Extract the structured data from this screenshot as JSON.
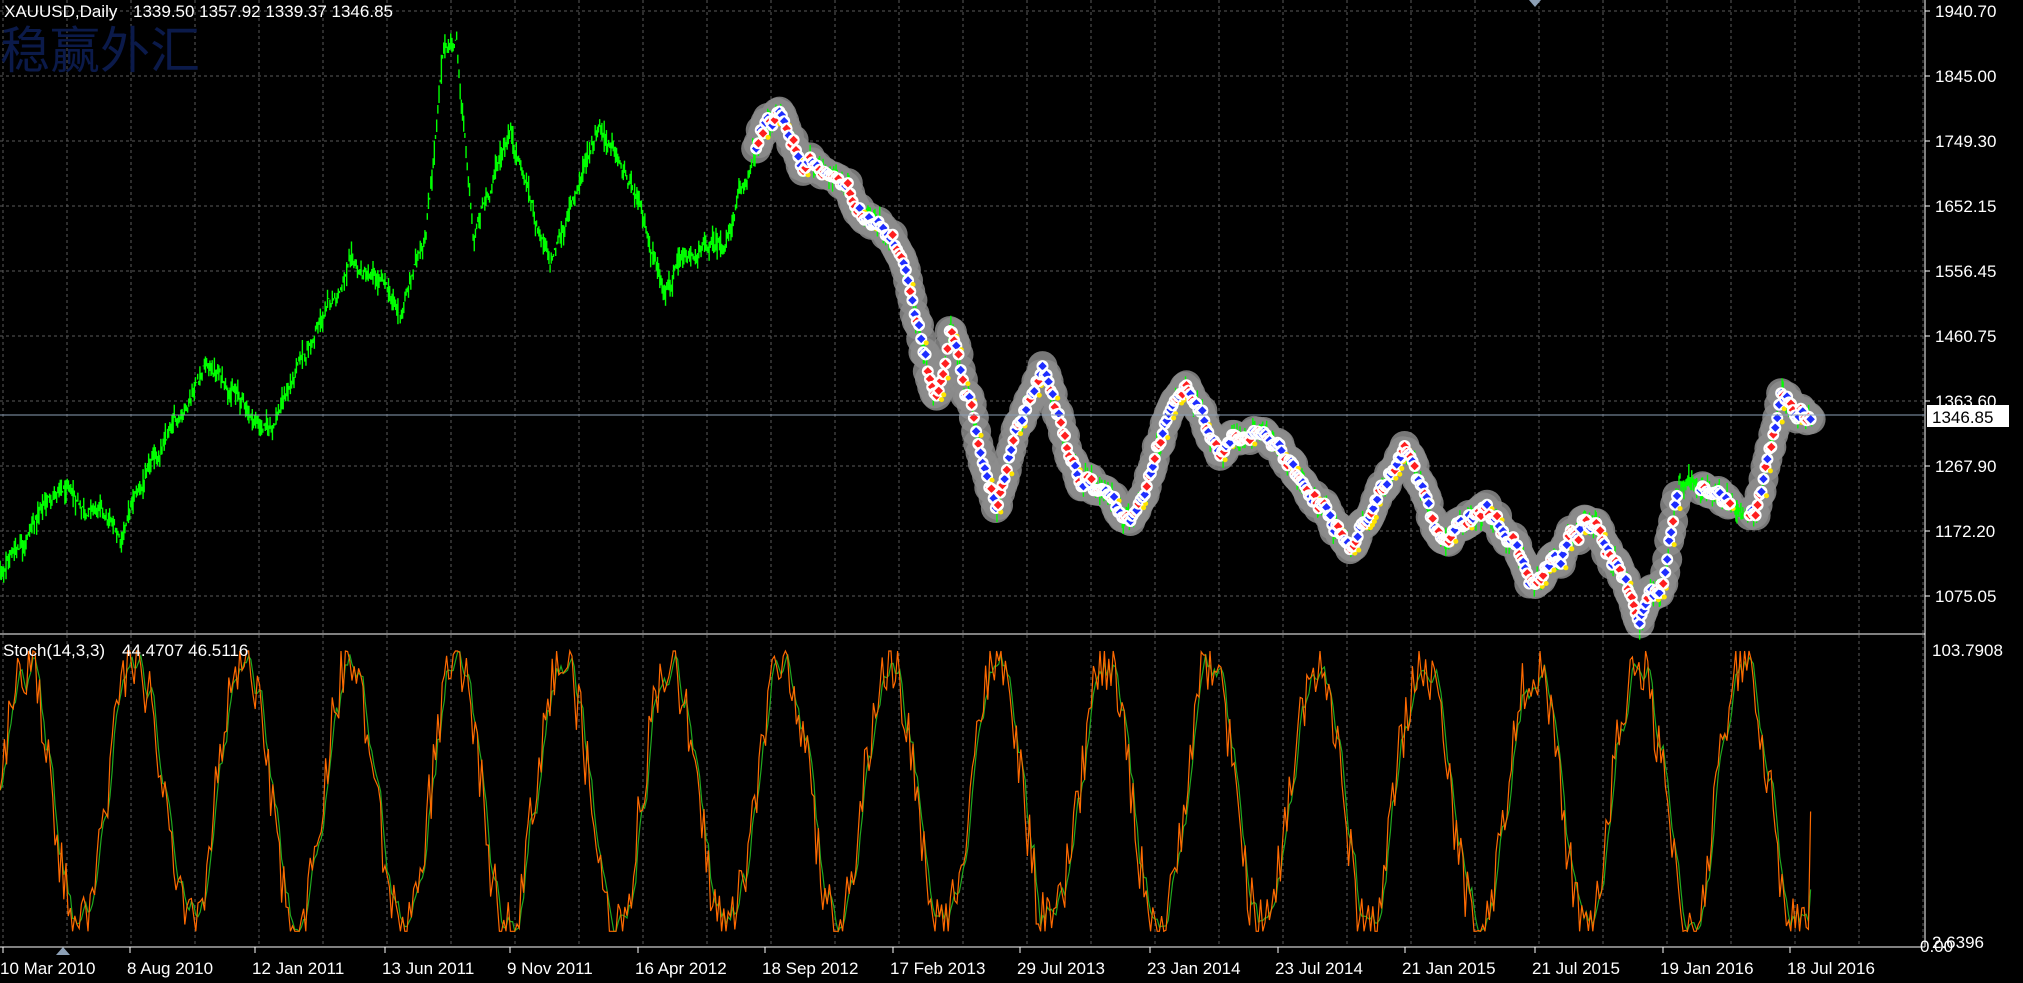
{
  "header": {
    "symbol": "XAUUSD,Daily",
    "ohlc": "1339.50 1357.92 1339.37 1346.85",
    "watermark": "稳赢外汇"
  },
  "current_price_label": "1346.85",
  "indicator": {
    "name": "Stoch(14,3,3)",
    "values": "44.4707 46.5116",
    "scale_top": "103.7908",
    "scale_low": "2.6396",
    "scale_bottom": "0.00"
  },
  "colors": {
    "background": "#000000",
    "grid": "#5a5a5a",
    "candles": "#00ff00",
    "halo": "#8c8c8c",
    "marker_blue": "#1e2dff",
    "marker_red": "#ff1e1e",
    "stoch_main": "#ff6a00",
    "stoch_signal": "#1fa81f"
  },
  "chart_data": [
    {
      "type": "line",
      "title": "XAUUSD,Daily",
      "y_ticks": [
        "1940.70",
        "1845.00",
        "1749.30",
        "1652.15",
        "1556.45",
        "1460.75",
        "1363.60",
        "1267.90",
        "1172.20",
        "1075.05"
      ],
      "ylim": [
        1030,
        1970
      ],
      "x_tick_labels": [
        "10 Mar 2010",
        "8 Aug 2010",
        "12 Jan 2011",
        "13 Jun 2011",
        "9 Nov 2011",
        "16 Apr 2012",
        "18 Sep 2012",
        "17 Feb 2013",
        "29 Jul 2013",
        "23 Jan 2014",
        "23 Jul 2014",
        "21 Jan 2015",
        "21 Jul 2015",
        "19 Jan 2016",
        "18 Jul 2016"
      ],
      "series": [
        {
          "values_approx": [
            {
              "date": "2010-02-01",
              "price": 1085
            },
            {
              "date": "2010-03-10",
              "price": 1120
            },
            {
              "date": "2010-05-10",
              "price": 1230
            },
            {
              "date": "2010-07-01",
              "price": 1200
            },
            {
              "date": "2010-07-28",
              "price": 1160
            },
            {
              "date": "2010-08-08",
              "price": 1205
            },
            {
              "date": "2010-10-01",
              "price": 1320
            },
            {
              "date": "2010-11-09",
              "price": 1420
            },
            {
              "date": "2010-12-10",
              "price": 1390
            },
            {
              "date": "2011-01-12",
              "price": 1335
            },
            {
              "date": "2011-01-28",
              "price": 1320
            },
            {
              "date": "2011-03-07",
              "price": 1420
            },
            {
              "date": "2011-05-02",
              "price": 1560
            },
            {
              "date": "2011-06-13",
              "price": 1530
            },
            {
              "date": "2011-07-01",
              "price": 1485
            },
            {
              "date": "2011-08-01",
              "price": 1620
            },
            {
              "date": "2011-08-22",
              "price": 1880
            },
            {
              "date": "2011-09-06",
              "price": 1900
            },
            {
              "date": "2011-09-26",
              "price": 1600
            },
            {
              "date": "2011-11-09",
              "price": 1770
            },
            {
              "date": "2011-12-29",
              "price": 1560
            },
            {
              "date": "2012-02-28",
              "price": 1780
            },
            {
              "date": "2012-04-16",
              "price": 1650
            },
            {
              "date": "2012-05-16",
              "price": 1540
            },
            {
              "date": "2012-07-01",
              "price": 1580
            },
            {
              "date": "2012-08-01",
              "price": 1600
            },
            {
              "date": "2012-09-18",
              "price": 1770
            },
            {
              "date": "2012-10-05",
              "price": 1790
            },
            {
              "date": "2012-11-01",
              "price": 1720
            },
            {
              "date": "2012-12-01",
              "price": 1710
            },
            {
              "date": "2013-01-01",
              "price": 1660
            },
            {
              "date": "2013-02-17",
              "price": 1610
            },
            {
              "date": "2013-03-01",
              "price": 1580
            },
            {
              "date": "2013-04-15",
              "price": 1360
            },
            {
              "date": "2013-05-01",
              "price": 1470
            },
            {
              "date": "2013-06-28",
              "price": 1200
            },
            {
              "date": "2013-07-29",
              "price": 1330
            },
            {
              "date": "2013-08-28",
              "price": 1420
            },
            {
              "date": "2013-10-15",
              "price": 1260
            },
            {
              "date": "2013-12-31",
              "price": 1190
            },
            {
              "date": "2014-01-23",
              "price": 1260
            },
            {
              "date": "2014-03-17",
              "price": 1390
            },
            {
              "date": "2014-05-01",
              "price": 1290
            },
            {
              "date": "2014-06-20",
              "price": 1320
            },
            {
              "date": "2014-07-23",
              "price": 1300
            },
            {
              "date": "2014-11-05",
              "price": 1140
            },
            {
              "date": "2015-01-21",
              "price": 1300
            },
            {
              "date": "2015-03-15",
              "price": 1150
            },
            {
              "date": "2015-05-15",
              "price": 1220
            },
            {
              "date": "2015-07-21",
              "price": 1090
            },
            {
              "date": "2015-10-15",
              "price": 1190
            },
            {
              "date": "2015-12-17",
              "price": 1050
            },
            {
              "date": "2016-01-19",
              "price": 1100
            },
            {
              "date": "2016-02-11",
              "price": 1250
            },
            {
              "date": "2016-04-01",
              "price": 1220
            },
            {
              "date": "2016-06-01",
              "price": 1210
            },
            {
              "date": "2016-07-06",
              "price": 1370
            },
            {
              "date": "2016-08-18",
              "price": 1346.85
            }
          ]
        }
      ]
    },
    {
      "type": "line",
      "title": "Stoch(14,3,3)",
      "ylim": [
        0,
        103.7908
      ],
      "series": [
        {
          "name": "%K",
          "last_value": 44.4707
        },
        {
          "name": "%D",
          "last_value": 46.5116
        }
      ]
    }
  ]
}
